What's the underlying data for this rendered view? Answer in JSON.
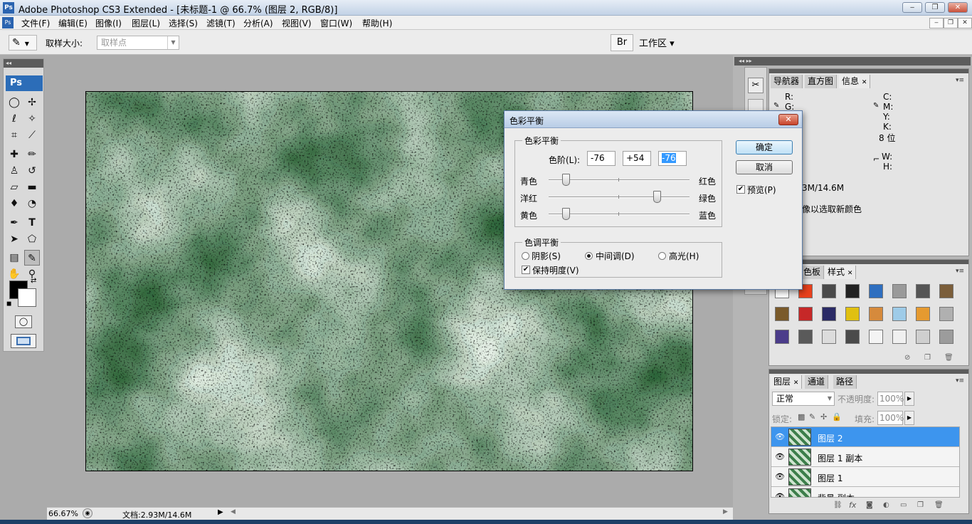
{
  "window": {
    "title": "Adobe Photoshop CS3 Extended - [未标题-1 @ 66.7% (图层 2, RGB/8)]",
    "app_icon": "Ps",
    "buttons": {
      "minimize": "‒",
      "restore": "❐",
      "close": "✕"
    }
  },
  "menubar": {
    "items": [
      "文件(F)",
      "编辑(E)",
      "图像(I)",
      "图层(L)",
      "选择(S)",
      "滤镜(T)",
      "分析(A)",
      "视图(V)",
      "窗口(W)",
      "帮助(H)"
    ],
    "doc_buttons": {
      "minimize": "‒",
      "restore": "❐",
      "close": "✕"
    }
  },
  "options": {
    "tool_icon": "eyedropper-icon",
    "sample_size_label": "取样大小:",
    "sample_size_value": "取样点",
    "workspace_label": "工作区 ▾",
    "bridge_icon": "bridge-icon"
  },
  "toolbox": {
    "logo": "Ps",
    "tools": [
      "marquee-icon",
      "move-icon",
      "lasso-icon",
      "magic-wand-icon",
      "crop-icon",
      "slice-icon",
      "healing-icon",
      "brush-icon",
      "stamp-icon",
      "history-brush-icon",
      "eraser-icon",
      "gradient-icon",
      "blur-icon",
      "dodge-icon",
      "pen-icon",
      "type-icon",
      "path-select-icon",
      "shape-icon",
      "notes-icon",
      "eyedropper-icon",
      "hand-icon",
      "zoom-icon"
    ],
    "foreground": "#000000",
    "background": "#ffffff"
  },
  "status": {
    "zoom": "66.67%",
    "doc_size": "文档:2.93M/14.6M"
  },
  "info_panel": {
    "tabs": [
      "导航器",
      "直方图",
      "信息"
    ],
    "active_tab": "信息",
    "labels_left": [
      "R:",
      "G:",
      "B:"
    ],
    "labels_right": [
      "C:",
      "M:",
      "Y:",
      "K:"
    ],
    "bit_depth_right": "8 位",
    "wh_labels": [
      "W:",
      "H:"
    ],
    "doc_info": "3M/14.6M",
    "hint": "像以选取新颜色"
  },
  "styles_panel": {
    "tabs": [
      "色板",
      "样式"
    ],
    "active_tab": "样式",
    "swatches": [
      "#ffffff",
      "#e8401c",
      "#4a4a4a",
      "#222222",
      "#2f6fc0",
      "#9a9a9a",
      "#555555",
      "#7b5e3a",
      "#7a5a2a",
      "#c62828",
      "#2a2a66",
      "#e0c010",
      "#d68a3c",
      "#9ecbe8",
      "#e59a30",
      "#b0b0b0",
      "#4b3c8a",
      "#5a5a5a",
      "#dcdcdc",
      "#4a4a4a",
      "#f4f4f4",
      "#f0f0f0",
      "#cfcfcf",
      "#9c9c9c"
    ]
  },
  "layers_panel": {
    "tabs": [
      "图层",
      "通道",
      "路径"
    ],
    "active_tab": "图层",
    "blend_mode": "正常",
    "opacity_label": "不透明度:",
    "opacity_value": "100%",
    "lock_label": "锁定:",
    "fill_label": "填充:",
    "fill_value": "100%",
    "layers": [
      {
        "name": "图层 2",
        "selected": true
      },
      {
        "name": "图层 1 副本",
        "selected": false
      },
      {
        "name": "图层 1",
        "selected": false
      },
      {
        "name": "背景 副本",
        "selected": false
      }
    ]
  },
  "color_balance_dialog": {
    "title": "色彩平衡",
    "group1_legend": "色彩平衡",
    "levels_label": "色阶(L):",
    "levels": [
      "-76",
      "+54",
      "-76"
    ],
    "sliders": [
      {
        "left": "青色",
        "right": "红色",
        "value": -76
      },
      {
        "left": "洋红",
        "right": "绿色",
        "value": 54
      },
      {
        "left": "黄色",
        "right": "蓝色",
        "value": -76
      }
    ],
    "group2_legend": "色调平衡",
    "tone_options": [
      "阴影(S)",
      "中间调(D)",
      "高光(H)"
    ],
    "tone_selected": "中间调(D)",
    "preserve_label": "保持明度(V)",
    "preserve_checked": true,
    "ok_label": "确定",
    "cancel_label": "取消",
    "preview_label": "预览(P)",
    "preview_checked": true,
    "close_icon": "✕"
  }
}
